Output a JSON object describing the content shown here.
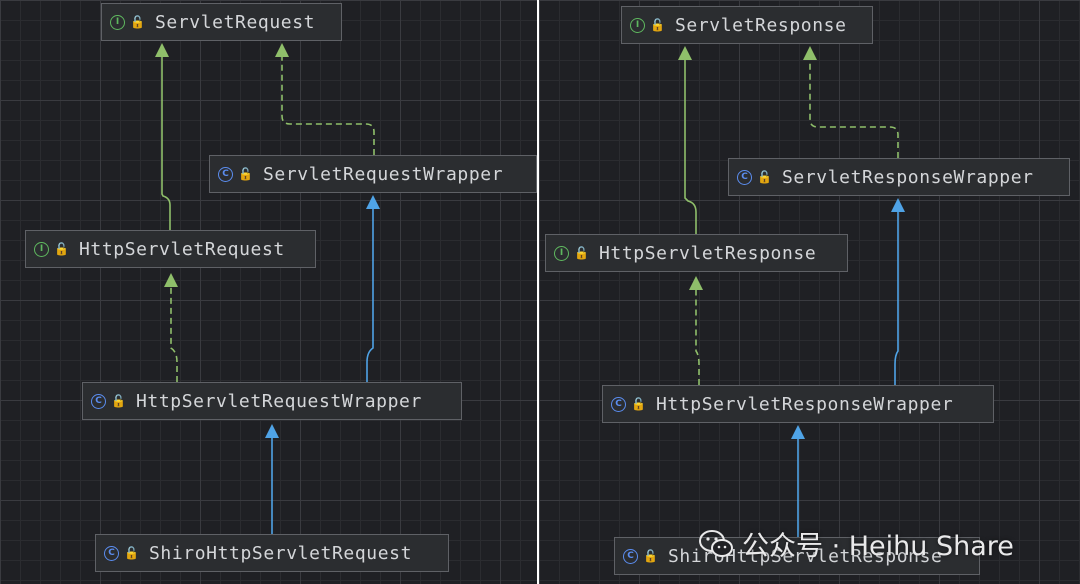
{
  "colors": {
    "implements": "#8fbf6a",
    "extends": "#4fa3e6",
    "background": "#1f2024",
    "node_fill": "#2b2d30"
  },
  "left_diagram": {
    "nodes": {
      "servlet_request": {
        "kind": "interface",
        "kind_glyph": "I",
        "name": "ServletRequest"
      },
      "servlet_request_wrapper": {
        "kind": "class",
        "kind_glyph": "C",
        "name": "ServletRequestWrapper"
      },
      "http_servlet_request": {
        "kind": "interface",
        "kind_glyph": "I",
        "name": "HttpServletRequest"
      },
      "http_servlet_request_wrapper": {
        "kind": "class",
        "kind_glyph": "C",
        "name": "HttpServletRequestWrapper"
      },
      "shiro_http_servlet_request": {
        "kind": "class",
        "kind_glyph": "C",
        "name": "ShiroHttpServletRequest"
      }
    }
  },
  "right_diagram": {
    "nodes": {
      "servlet_response": {
        "kind": "interface",
        "kind_glyph": "I",
        "name": "ServletResponse"
      },
      "servlet_response_wrapper": {
        "kind": "class",
        "kind_glyph": "C",
        "name": "ServletResponseWrapper"
      },
      "http_servlet_response": {
        "kind": "interface",
        "kind_glyph": "I",
        "name": "HttpServletResponse"
      },
      "http_servlet_response_wrapper": {
        "kind": "class",
        "kind_glyph": "C",
        "name": "HttpServletResponseWrapper"
      },
      "shiro_http_servlet_response": {
        "kind": "class",
        "kind_glyph": "C",
        "name": "ShiroHttpServletResponse"
      }
    }
  },
  "watermark": {
    "icon": "wechat-icon",
    "text": "公众号 · Heihu Share"
  }
}
